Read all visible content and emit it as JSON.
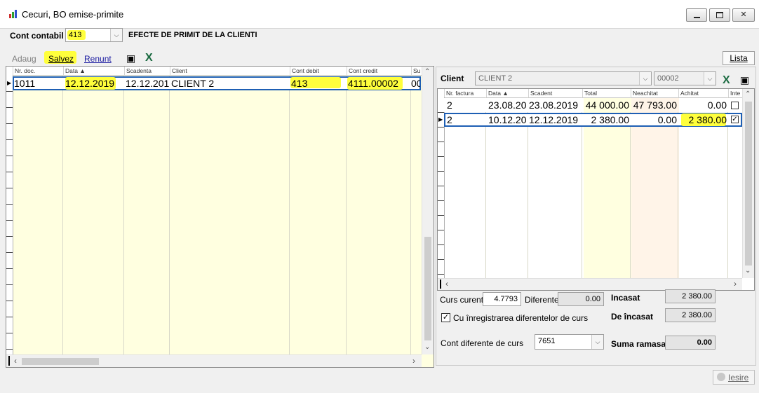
{
  "window": {
    "title": "Cecuri, BO emise-primite"
  },
  "header": {
    "cont_contabil_label": "Cont contabil",
    "cont_contabil_value": "413",
    "cont_description": "EFECTE DE PRIMIT DE LA CLIENTI"
  },
  "toolbar": {
    "adaug": "Adaug",
    "salvez": "Salvez",
    "renunt": "Renunt",
    "lista": "Lista"
  },
  "left_grid": {
    "columns": [
      "Nr. doc.",
      "Data",
      "Scadenta",
      "Client",
      "Cont debit",
      "Cont credit",
      "Su"
    ],
    "row": {
      "nr_doc": "1011",
      "data": "12.12.2019",
      "scadenta": "12.12.201",
      "client": "CLIENT 2",
      "cont_debit": "413",
      "cont_credit": "4111.00002",
      "suma": "00"
    }
  },
  "right_panel": {
    "client_label": "Client",
    "client_value": "CLIENT 2",
    "client_code": "00002",
    "columns": [
      "Nr. factura",
      "Data",
      "Scadent",
      "Total",
      "Neachitat",
      "Achitat",
      "Inte"
    ],
    "rows": [
      {
        "nr": "2",
        "data": "23.08.20",
        "scadent": "23.08.2019",
        "total": "44 000.00",
        "neachitat": "47 793.00",
        "achitat": "0.00",
        "checked": false
      },
      {
        "nr": "2",
        "data": "10.12.20",
        "scadent": "12.12.2019",
        "total": "2 380.00",
        "neachitat": "0.00",
        "achitat": "2 380.00",
        "checked": true
      }
    ],
    "curs_curent_label": "Curs curent",
    "curs_curent_value": "4.7793",
    "diferente_label": "Diferente",
    "diferente_value": "0.00",
    "incasat_label": "Incasat",
    "incasat_value": "2 380.00",
    "de_incasat_label": "De încasat",
    "de_incasat_value": "2 380.00",
    "cu_inreg_label": "Cu înregistrarea diferentelor de curs",
    "cont_dif_label": "Cont diferente de curs",
    "cont_dif_value": "7651",
    "suma_ramasa_label": "Suma ramasa",
    "suma_ramasa_value": "0.00"
  },
  "footer": {
    "iesire": "Iesire"
  },
  "colors": {
    "grid_bg": "#ffffe0",
    "highlight": "#ffff3c",
    "link_blue": "#1a1aa0"
  }
}
